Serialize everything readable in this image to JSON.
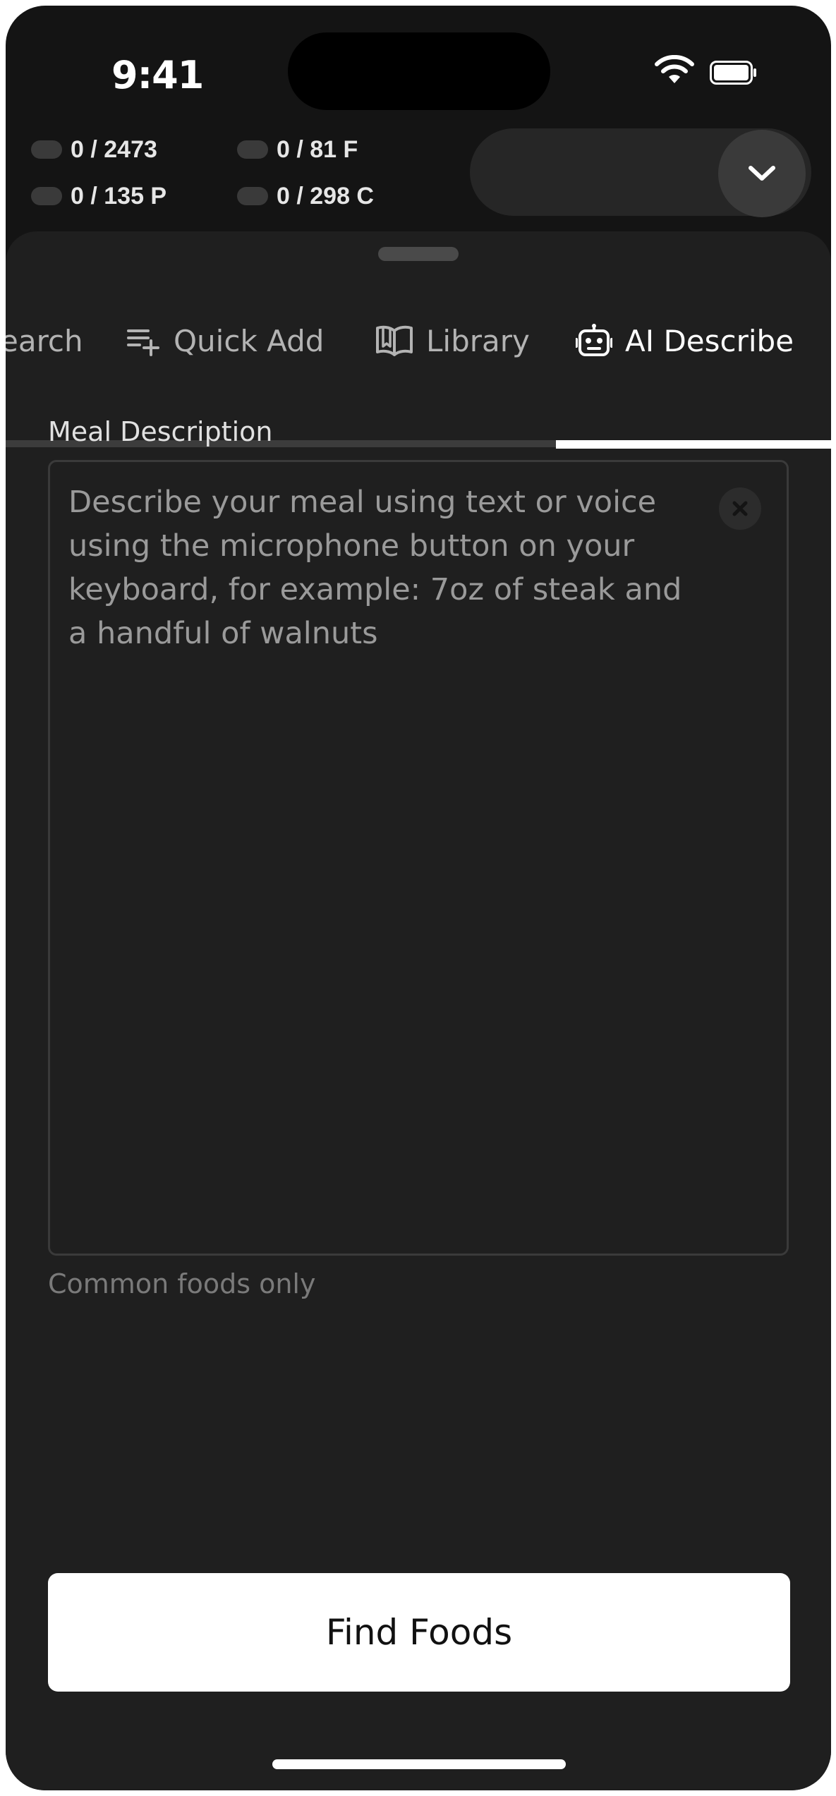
{
  "status_bar": {
    "time": "9:41"
  },
  "macros": {
    "calories": "0 / 2473",
    "protein": "0 / 135 P",
    "fat": "0 / 81 F",
    "carbs": "0 / 298 C"
  },
  "tabs": [
    {
      "label": "Search",
      "visible_label": "earch",
      "icon": "search-icon"
    },
    {
      "label": "Quick Add",
      "icon": "playlist-add-icon"
    },
    {
      "label": "Library",
      "icon": "book-open-icon"
    },
    {
      "label": "AI Describe",
      "icon": "robot-icon",
      "active": true
    }
  ],
  "meal_form": {
    "label": "Meal Description",
    "value": "",
    "placeholder": "Describe your meal using text or voice using the microphone button on your keyboard, for example: 7oz of steak and a handful of walnuts",
    "helper": "Common foods only",
    "clear_icon": "close-icon"
  },
  "actions": {
    "find_foods": "Find Foods"
  },
  "colors": {
    "background": "#141414",
    "sheet": "#1f1f1f",
    "accent": "#ffffff",
    "muted": "#7a7a7a"
  }
}
